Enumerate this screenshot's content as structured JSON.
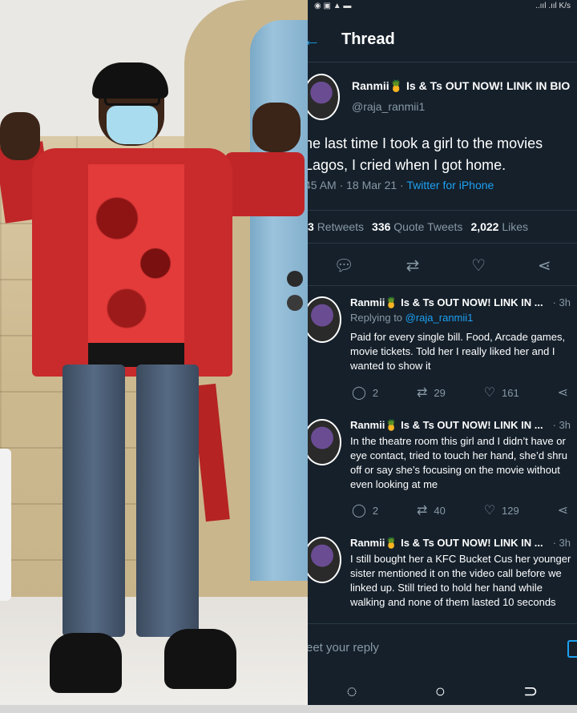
{
  "statusbar": {
    "right": "..ııl .ııl K/s"
  },
  "header": {
    "back_icon": "arrow-left-icon",
    "title": "Thread"
  },
  "main_tweet": {
    "name": "Ranmii🍍 Is & Ts OUT NOW! LINK IN BIO",
    "handle": "@raja_ranmii1",
    "text": "he last time I took a girl to the movies Lagos, I cried when I got home.",
    "time": "45 AM · 18 Mar 21 · ",
    "source": "Twitter for iPhone",
    "retweets_count": "3",
    "retweets_label": "Retweets",
    "quote_count": "336",
    "quote_label": "Quote Tweets",
    "likes_count": "2,022",
    "likes_label": "Likes"
  },
  "replies": [
    {
      "name": "Ranmii🍍 Is & Ts OUT NOW! LINK IN ...",
      "time": "· 3h",
      "replying_label": "Replying to ",
      "replying_handle": "@raja_ranmii1",
      "text": "Paid for every single bill. Food, Arcade games,\nmovie tickets. Told her I really liked her and I\nwanted to show it",
      "replies": "2",
      "retweets": "29",
      "likes": "161"
    },
    {
      "name": "Ranmii🍍 Is & Ts OUT NOW! LINK IN ...",
      "time": "· 3h",
      "text": "In the theatre room this girl and I didn’t have or\neye contact, tried to touch her hand, she’d shru\noff or say she’s focusing on the movie without\neven looking at me",
      "replies": "2",
      "retweets": "40",
      "likes": "129"
    },
    {
      "name": "Ranmii🍍 Is & Ts OUT NOW! LINK IN ...",
      "time": "· 3h",
      "text": "I still bought her a KFC Bucket Cus her younger\nsister mentioned it on the video call before we\nlinked up. Still tried to hold her hand while\nwalking and none of them lasted 10 seconds"
    }
  ],
  "reply_bar": {
    "placeholder": "eet your reply"
  }
}
